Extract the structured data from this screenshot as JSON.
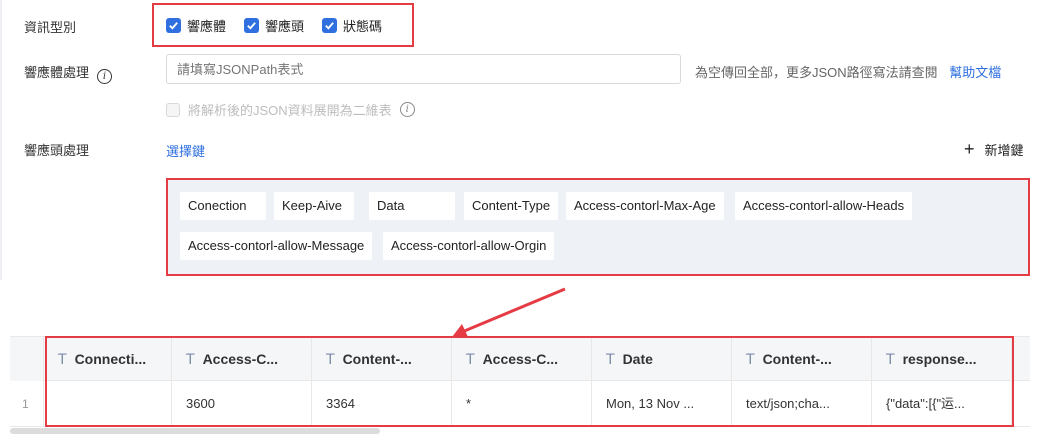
{
  "info_type": {
    "label": "資訊型別",
    "options": [
      {
        "label": "響應體",
        "checked": true
      },
      {
        "label": "響應頭",
        "checked": true
      },
      {
        "label": "狀態碼",
        "checked": true
      }
    ]
  },
  "body_processing": {
    "label": "響應體處理",
    "placeholder": "請填寫JSONPath表式",
    "hint": "為空傳回全部，更多JSON路徑寫法請查閱",
    "help_link": "幫助文檔",
    "flatten_label": "將解析後的JSON資料展開為二維表"
  },
  "header_processing": {
    "label": "響應頭處理",
    "select_key": "選擇鍵",
    "add_key": "新增鍵",
    "tags": [
      "Conection",
      "Keep-Aive",
      "Data",
      "Content-Type",
      "Access-contorl-Max-Age",
      "Access-contorl-allow-Heads",
      "Access-contorl-allow-Message",
      "Access-contorl-allow-Orgin"
    ]
  },
  "table": {
    "type_glyph": "T",
    "columns": [
      "Connecti...",
      "Access-C...",
      "Content-...",
      "Access-C...",
      "Date",
      "Content-...",
      "response..."
    ],
    "rows": [
      {
        "num": "1",
        "cells": [
          "",
          "3600",
          "3364",
          "*",
          "Mon, 13 Nov ...",
          "text/json;cha...",
          "{\"data\":[{\"运..."
        ]
      }
    ]
  },
  "colors": {
    "accent": "#2f6fe0",
    "highlight": "#e53b45"
  }
}
